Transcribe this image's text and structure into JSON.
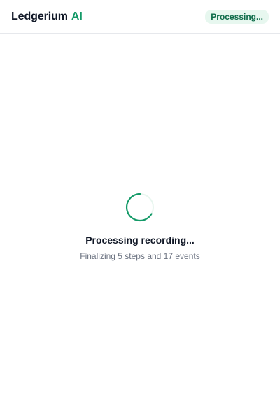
{
  "header": {
    "brand_name": "Ledgerium",
    "brand_accent": "AI",
    "status": "Processing..."
  },
  "main": {
    "title": "Processing recording...",
    "subtitle": "Finalizing 5 steps and 17 events",
    "spinner_icon": "loading-spinner-icon"
  },
  "colors": {
    "accent": "#149a68",
    "badge_bg": "#e7f7ef",
    "text": "#111827",
    "muted": "#6b7280"
  }
}
